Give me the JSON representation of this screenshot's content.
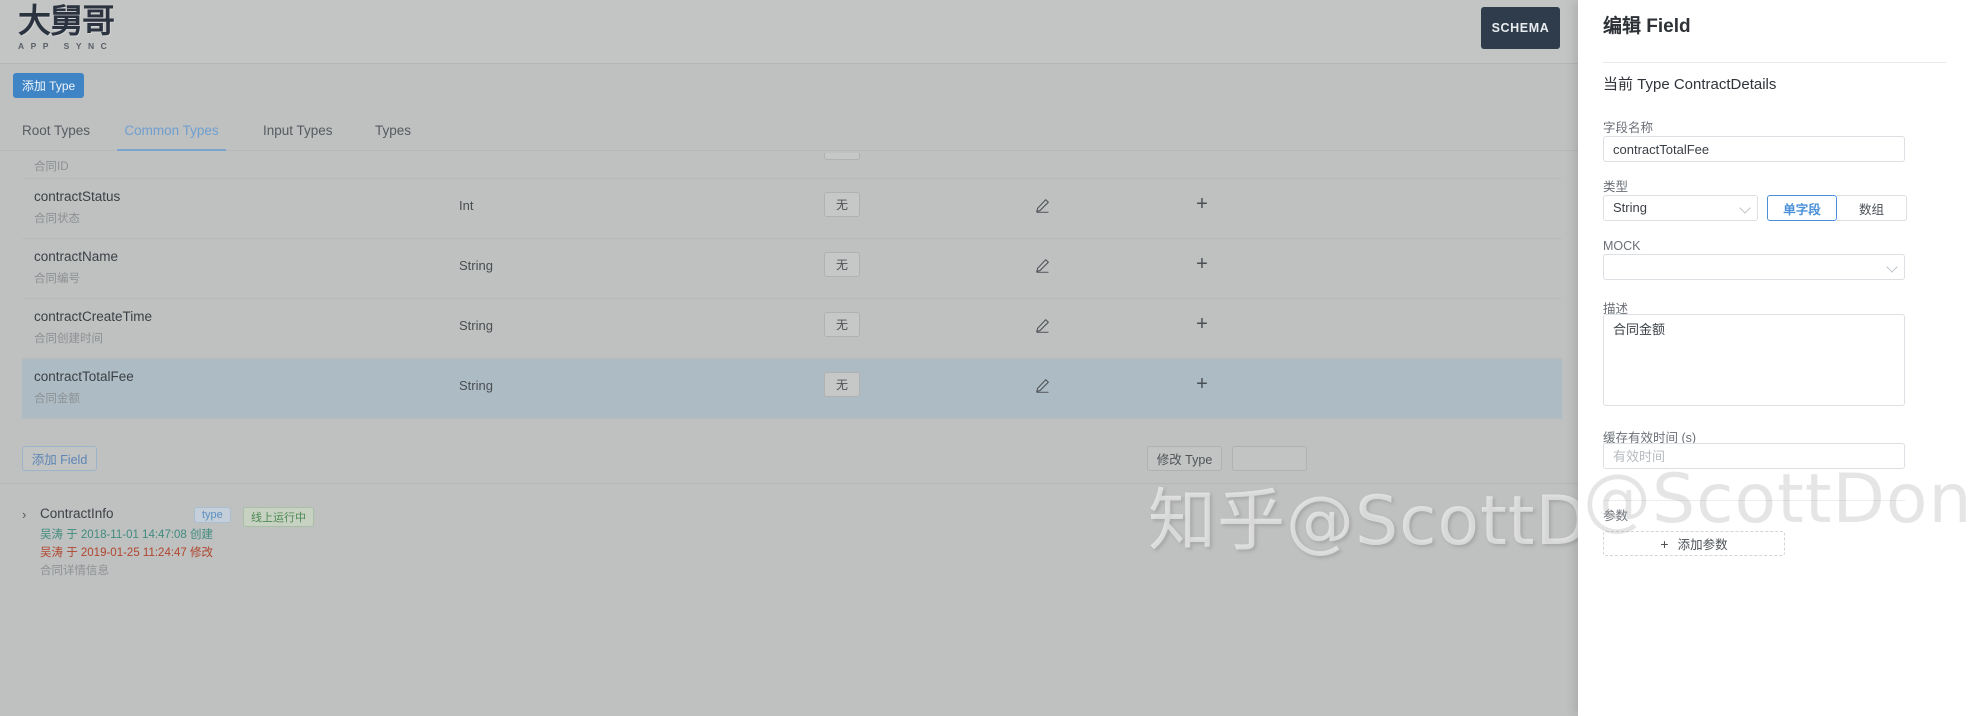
{
  "header": {
    "logo_cjk": "大舅哥",
    "logo_sub": "APP SYNC",
    "schema_button": "SCHEMA"
  },
  "toolbar": {
    "add_type_label": "添加 Type"
  },
  "tabs": [
    {
      "label": "Root Types",
      "active": false
    },
    {
      "label": "Common Types",
      "active": true
    },
    {
      "label": "Input Types",
      "active": false
    },
    {
      "label": "Types",
      "active": false
    }
  ],
  "field_table": {
    "none_label": "无",
    "plus_label": "+",
    "rows": [
      {
        "name": "",
        "desc": "合同ID",
        "type": "",
        "none": "无",
        "clipped": true,
        "selected": false
      },
      {
        "name": "contractStatus",
        "desc": "合同状态",
        "type": "Int",
        "none": "无",
        "clipped": false,
        "selected": false
      },
      {
        "name": "contractName",
        "desc": "合同编号",
        "type": "String",
        "none": "无",
        "clipped": false,
        "selected": false
      },
      {
        "name": "contractCreateTime",
        "desc": "合同创建时间",
        "type": "String",
        "none": "无",
        "clipped": false,
        "selected": false
      },
      {
        "name": "contractTotalFee",
        "desc": "合同金额",
        "type": "String",
        "none": "无",
        "clipped": false,
        "selected": true
      }
    ]
  },
  "actions": {
    "add_field_label": "添加 Field",
    "modify_type_label": "修改 Type"
  },
  "type_group": {
    "chevron": "›",
    "title": "ContractInfo",
    "badge_type": "type",
    "badge_status": "线上运行中",
    "created_text": "吴涛 于 2018-11-01 14:47:08 创建",
    "modified_text": "吴涛 于 2019-01-25 11:24:47 修改",
    "description": "合同详情信息"
  },
  "watermark": {
    "main": "知乎@ScottDong",
    "drawer": "@ScottDong"
  },
  "drawer": {
    "title": "编辑 Field",
    "subtitle": "当前 Type ContractDetails",
    "field_name_label": "字段名称",
    "field_name_value": "contractTotalFee",
    "type_label": "类型",
    "type_value": "String",
    "seg_single": "单字段",
    "seg_array": "数组",
    "mock_label": "MOCK",
    "mock_value": "",
    "desc_label": "描述",
    "desc_value": "合同金额",
    "cache_label": "缓存有效时间 (s)",
    "cache_placeholder": "有效时间",
    "cache_value": "",
    "params_label": "参数",
    "add_param_label": "添加参数",
    "add_param_plus": "+"
  },
  "colors": {
    "accent_blue": "#3f85c6",
    "tab_active": "#6f9fd0",
    "schema_dark": "#2f3c4b",
    "row_selected": "#adbcc4",
    "badge_type": "#5b8fc0",
    "badge_online": "#4d8a52",
    "created_green": "#3f8b7d",
    "modified_red": "#b0452e"
  }
}
